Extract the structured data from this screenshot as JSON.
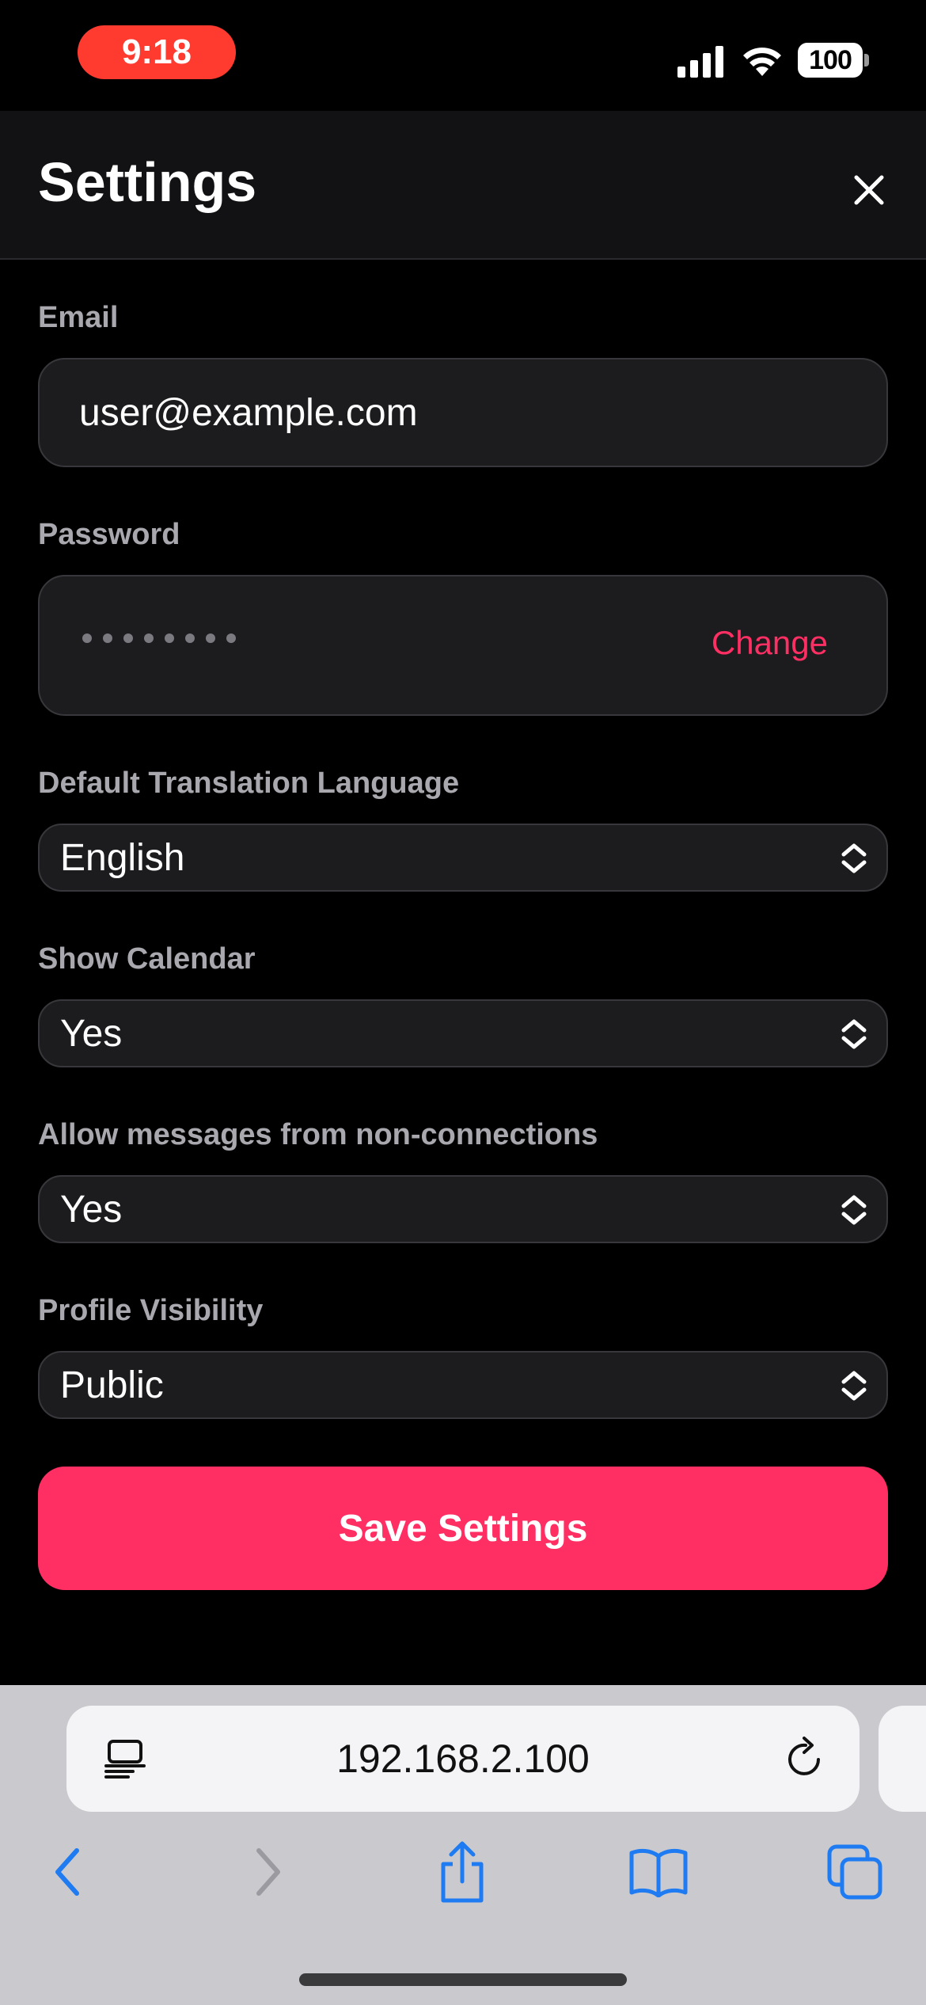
{
  "status_bar": {
    "time": "9:18",
    "battery": "100",
    "time_pill_color": "#FF3B30"
  },
  "header": {
    "title": "Settings",
    "close_icon": "close-icon"
  },
  "form": {
    "email": {
      "label": "Email",
      "value": "user@example.com"
    },
    "password": {
      "label": "Password",
      "masked_length": 8,
      "change_label": "Change"
    },
    "translation_language": {
      "label": "Default Translation Language",
      "selected": "English"
    },
    "show_calendar": {
      "label": "Show Calendar",
      "selected": "Yes"
    },
    "allow_messages": {
      "label": "Allow messages from non-connections",
      "selected": "Yes"
    },
    "profile_visibility": {
      "label": "Profile Visibility",
      "selected": "Public"
    },
    "save_label": "Save Settings"
  },
  "colors": {
    "accent": "#FF2E63",
    "background": "#000000",
    "field_background": "#1C1C1F"
  },
  "browser": {
    "url": "192.168.2.100",
    "icons": [
      "reader-icon",
      "reload-icon",
      "back-icon",
      "forward-icon",
      "share-icon",
      "bookmarks-icon",
      "tabs-icon"
    ]
  }
}
